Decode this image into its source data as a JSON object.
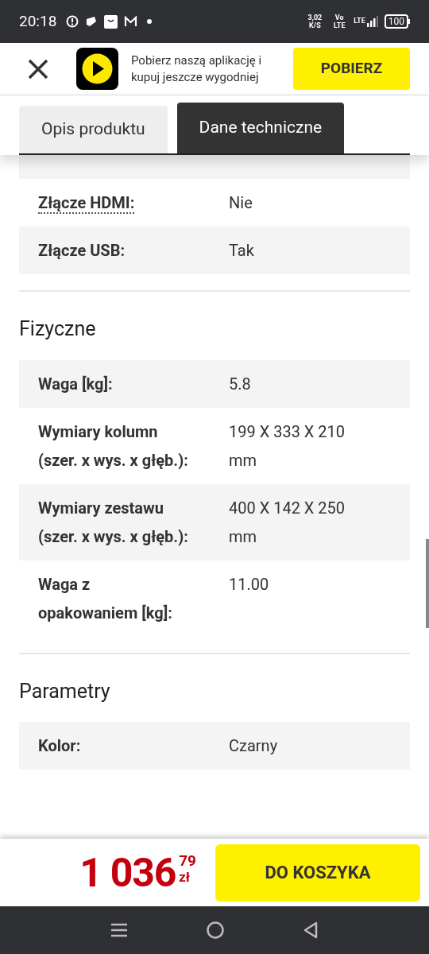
{
  "status_bar": {
    "time": "20:18",
    "speed": "3,02",
    "speed_unit": "K/S",
    "volte": "Vo LTE",
    "network": "LTE",
    "battery": "100"
  },
  "app_banner": {
    "text": "Pobierz naszą aplikację i kupuj jeszcze wygodniej",
    "button": "POBIERZ"
  },
  "tabs": [
    {
      "label": "Opis produktu",
      "selected": false
    },
    {
      "label": "Dane techniczne",
      "selected": true
    }
  ],
  "sections": [
    {
      "rows": [
        {
          "label": "Złącze HDMI:",
          "value": "Nie",
          "hint": true
        },
        {
          "label": "Złącze USB:",
          "value": "Tak",
          "hint": false
        }
      ]
    },
    {
      "heading": "Fizyczne",
      "rows": [
        {
          "label": "Waga [kg]:",
          "value": "5.8",
          "hint": false
        },
        {
          "label": "Wymiary kolumn (szer. x wys. x głęb.):",
          "value": "199 X 333 X 210 mm",
          "hint": false
        },
        {
          "label": "Wymiary zestawu (szer. x wys. x głęb.):",
          "value": "400 X 142 X 250 mm",
          "hint": false
        },
        {
          "label": "Waga z opakowaniem [kg]:",
          "value": "11.00",
          "hint": false
        }
      ]
    },
    {
      "heading": "Parametry",
      "rows": [
        {
          "label": "Kolor:",
          "value": "Czarny",
          "hint": false
        }
      ]
    }
  ],
  "price": {
    "main": "1 036",
    "cents": "79",
    "currency": "zł"
  },
  "cart_button": "DO KOSZYKA"
}
